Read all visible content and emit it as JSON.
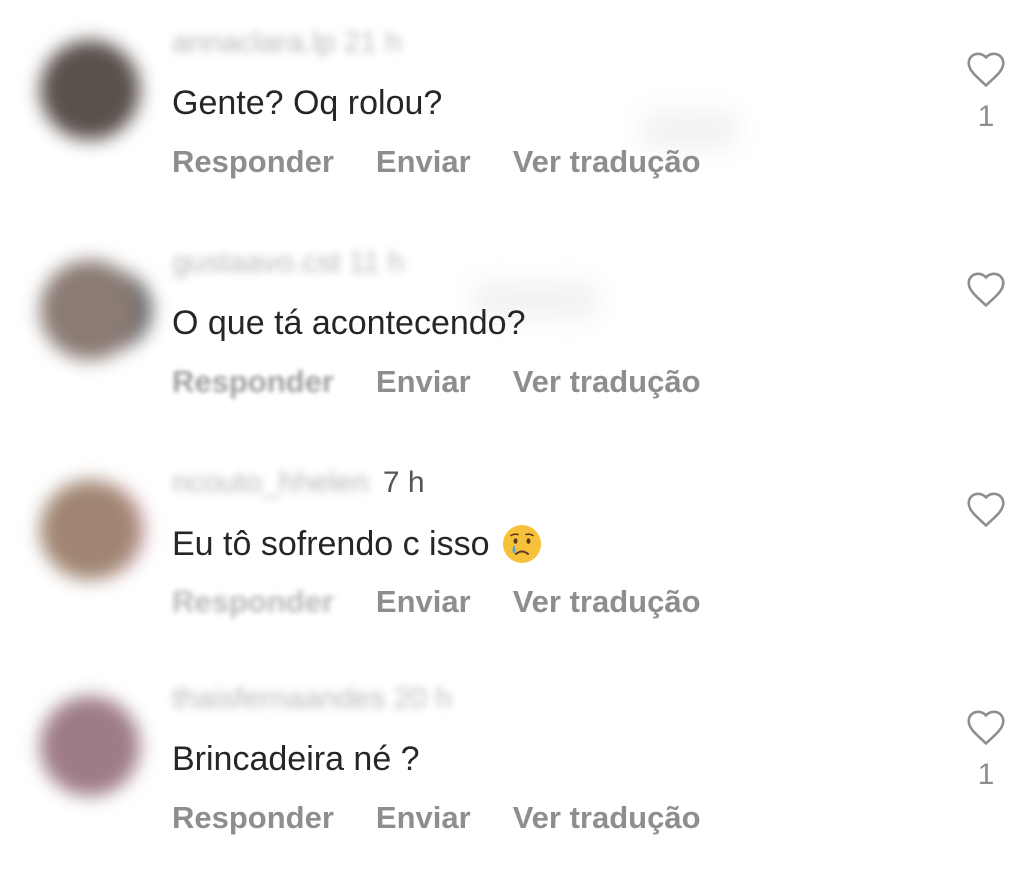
{
  "comments": [
    {
      "username": "annaclara.lp",
      "time": "21 h",
      "text": "Gente? Oq rolou?",
      "actions": {
        "reply": "Responder",
        "send": "Enviar",
        "translate": "Ver tradução"
      },
      "likes": "1"
    },
    {
      "username": "gustaavo.cst",
      "time": "11 h",
      "text": "O que tá acontecendo?",
      "actions": {
        "reply": "Responder",
        "send": "Enviar",
        "translate": "Ver tradução"
      },
      "likes": ""
    },
    {
      "username": "ncouto_hhelen",
      "time": "7 h",
      "text": "Eu tô sofrendo c isso",
      "emoji": "crying-face",
      "actions": {
        "reply": "Responder",
        "send": "Enviar",
        "translate": "Ver tradução"
      },
      "likes": ""
    },
    {
      "username": "thaisfernaandes",
      "time": "20 h",
      "text": "Brincadeira né ?",
      "actions": {
        "reply": "Responder",
        "send": "Enviar",
        "translate": "Ver tradução"
      },
      "likes": "1"
    }
  ],
  "colors": {
    "text": "#262626",
    "secondary": "#8e8e8e",
    "background": "#ffffff"
  },
  "icons": {
    "like": "heart-outline-icon",
    "emoji": "crying-face-emoji"
  }
}
